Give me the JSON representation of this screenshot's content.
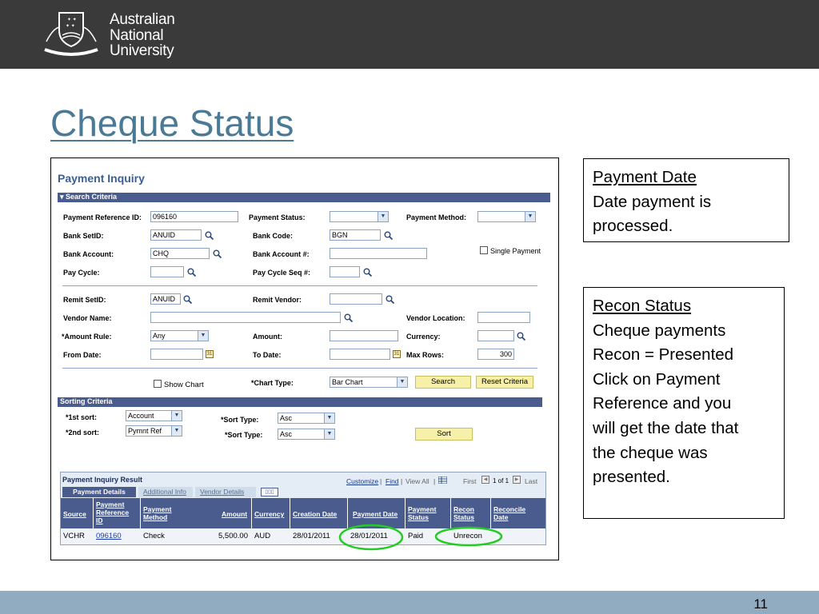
{
  "header": {
    "org_lines": [
      "Australian",
      "National",
      "University"
    ]
  },
  "slide": {
    "title": "Cheque Status",
    "page_number": "11"
  },
  "screen": {
    "title": "Payment Inquiry",
    "search_criteria_label": "Search Criteria",
    "fields": {
      "payment_ref_label": "Payment Reference ID:",
      "payment_ref_value": "096160",
      "payment_status_label": "Payment Status:",
      "payment_method_label": "Payment Method:",
      "bank_setid_label": "Bank SetID:",
      "bank_setid_value": "ANUID",
      "bank_code_label": "Bank Code:",
      "bank_code_value": "BGN",
      "bank_account_label": "Bank Account:",
      "bank_account_value": "CHQ",
      "bank_account_num_label": "Bank Account #:",
      "single_payment_label": "Single Payment",
      "pay_cycle_label": "Pay Cycle:",
      "pay_cycle_seq_label": "Pay Cycle Seq #:",
      "remit_setid_label": "Remit SetID:",
      "remit_setid_value": "ANUID",
      "remit_vendor_label": "Remit Vendor:",
      "vendor_name_label": "Vendor Name:",
      "vendor_location_label": "Vendor Location:",
      "amount_rule_label": "*Amount Rule:",
      "amount_rule_value": "Any",
      "amount_label": "Amount:",
      "currency_label": "Currency:",
      "from_date_label": "From Date:",
      "to_date_label": "To Date:",
      "max_rows_label": "Max Rows:",
      "max_rows_value": "300",
      "show_chart_label": "Show Chart",
      "chart_type_label": "*Chart Type:",
      "chart_type_value": "Bar Chart",
      "search_button": "Search",
      "reset_button": "Reset Criteria"
    },
    "sorting": {
      "bar_label": "Sorting Criteria",
      "first_sort_label": "*1st sort:",
      "first_sort_value": "Account",
      "second_sort_label": "*2nd sort:",
      "second_sort_value": "Pymnt Ref",
      "sort_type_label": "*Sort Type:",
      "sort_type_1": "Asc",
      "sort_type_2": "Asc",
      "sort_button": "Sort"
    },
    "result": {
      "title": "Payment Inquiry Result",
      "links": {
        "customize": "Customize",
        "find": "Find",
        "view_all": "View All",
        "first": "First",
        "range": "1 of 1",
        "last": "Last"
      },
      "tabs": [
        "Payment Details",
        "Additional Info",
        "Vendor Details"
      ],
      "columns": [
        "Source",
        "Payment Reference ID",
        "Payment Method",
        "Amount",
        "Currency",
        "Creation Date",
        "Payment Date",
        "Payment Status",
        "Recon Status",
        "Reconcile Date"
      ],
      "rows": [
        [
          "VCHR",
          "096160",
          "Check",
          "5,500.00",
          "AUD",
          "28/01/2011",
          "28/01/2011",
          "Paid",
          "Unrecon",
          ""
        ]
      ]
    }
  },
  "notes": [
    {
      "heading": "Payment Date",
      "lines": [
        "Date payment is",
        "processed."
      ]
    },
    {
      "heading": "Recon Status",
      "lines": [
        "Cheque payments",
        "Recon = Presented",
        "Click on Payment",
        "Reference and you",
        "will get the date that",
        "the cheque was",
        "presented."
      ]
    }
  ],
  "colors": {
    "highlight": "#22cc22",
    "bar": "#4a5c8e",
    "title": "#4a7a96"
  }
}
